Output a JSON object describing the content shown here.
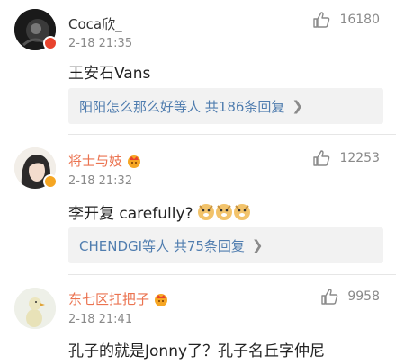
{
  "comments": [
    {
      "username": "Coca欣_",
      "time": "2-18 21:35",
      "likes": "16180",
      "text": "王安石Vans",
      "reply_summary": "阳阳怎么那么好等人 共186条回复",
      "avatar_icon": "dark-avatar",
      "badge_color": "#e8432d"
    },
    {
      "username": "将士与妓",
      "time": "2-18 21:32",
      "likes": "12253",
      "text": "李开复 carefully?",
      "reply_summary": "CHENDGI等人 共75条回复",
      "avatar_icon": "woman-avatar",
      "badge_color": "#f5a623"
    },
    {
      "username": "东七区扛把子",
      "time": "2-18 21:41",
      "likes": "9958",
      "text": "孔子的就是Jonny了？孔子名丘字仲尼",
      "avatar_icon": "duck-avatar"
    }
  ],
  "colors": {
    "accent_orange": "#eb7350",
    "link_blue": "#507daf",
    "meta_gray": "#8a8a8a"
  }
}
